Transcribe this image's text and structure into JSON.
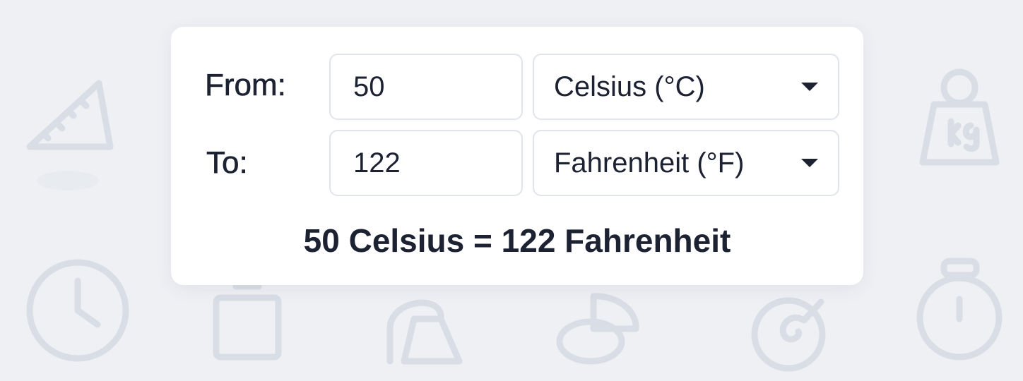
{
  "converter": {
    "from_label": "From:",
    "to_label": "To:",
    "from_value": "50",
    "to_value": "122",
    "from_unit": "Celsius (°C)",
    "to_unit": "Fahrenheit (°F)",
    "result_text": "50 Celsius = 122 Fahrenheit"
  },
  "background_icons": [
    "ruler-triangle-icon",
    "weight-kg-icon",
    "clock-icon",
    "square-icon",
    "bag-weight-icon",
    "pie-chart-icon",
    "gauge-icon",
    "stopwatch-icon"
  ],
  "theme": {
    "background": "#eff0f4",
    "card": "#ffffff",
    "text": "#1d2233",
    "border": "#e1e4ea",
    "icon": "#d9dde6"
  }
}
